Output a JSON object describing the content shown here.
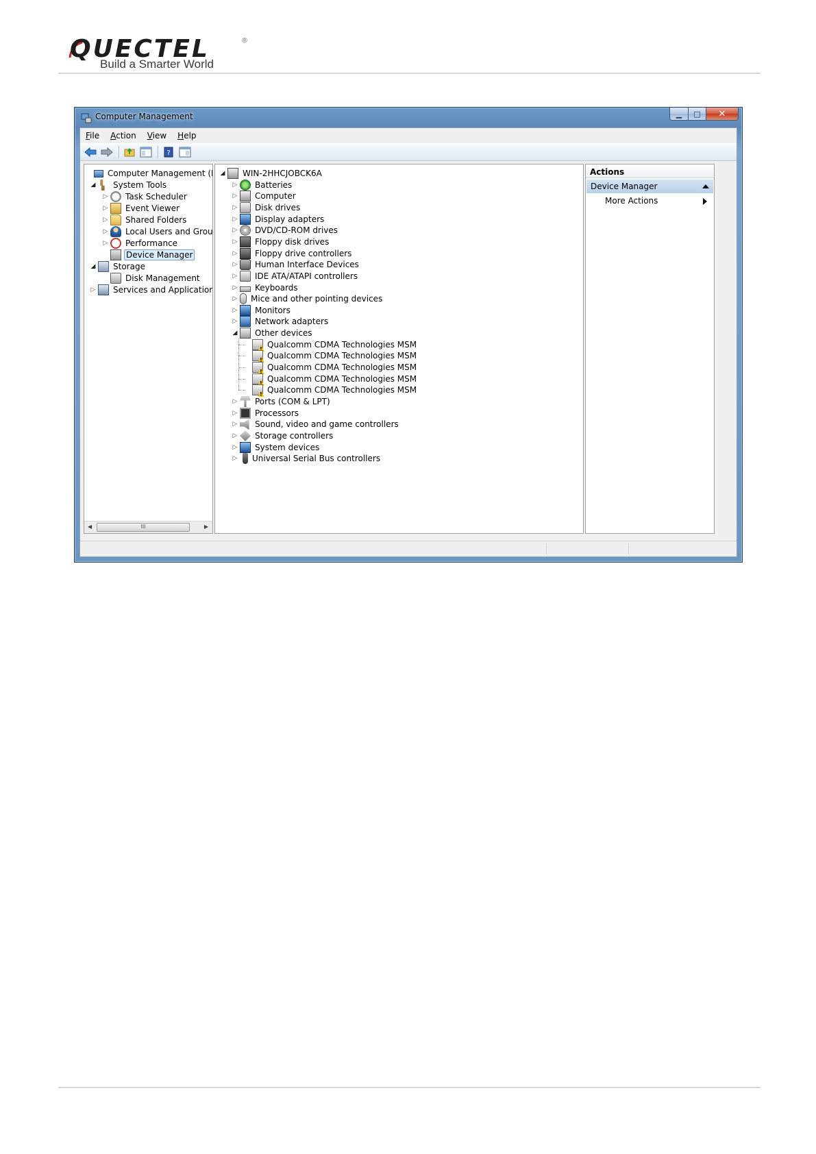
{
  "logo": {
    "wordmark": "QUECTEL",
    "registered": "®",
    "tagline": "Build a Smarter World"
  },
  "window": {
    "title": "Computer Management",
    "caption": {
      "minimize": "▁",
      "maximize": "□",
      "close": "✕"
    }
  },
  "menu": {
    "file": {
      "accel": "F",
      "rest": "ile"
    },
    "action": {
      "accel": "A",
      "rest": "ction"
    },
    "view": {
      "accel": "V",
      "rest": "iew"
    },
    "help": {
      "accel": "H",
      "rest": "elp"
    }
  },
  "left_tree": [
    {
      "label": "Computer Management (Local",
      "icon": "computer-management-icon"
    },
    {
      "label": "System Tools",
      "icon": "system-tools-icon"
    },
    {
      "label": "Task Scheduler",
      "icon": "task-scheduler-icon"
    },
    {
      "label": "Event Viewer",
      "icon": "event-viewer-icon"
    },
    {
      "label": "Shared Folders",
      "icon": "shared-folders-icon"
    },
    {
      "label": "Local Users and Groups",
      "icon": "local-users-icon"
    },
    {
      "label": "Performance",
      "icon": "performance-icon"
    },
    {
      "label": "Device Manager",
      "icon": "device-manager-icon"
    },
    {
      "label": "Storage",
      "icon": "storage-icon"
    },
    {
      "label": "Disk Management",
      "icon": "disk-management-icon"
    },
    {
      "label": "Services and Applications",
      "icon": "services-icon"
    }
  ],
  "left_scroll": {
    "thumb": "III"
  },
  "device_tree": {
    "root": "WIN-2HHCJOBCK6A",
    "categories": [
      "Batteries",
      "Computer",
      "Disk drives",
      "Display adapters",
      "DVD/CD-ROM drives",
      "Floppy disk drives",
      "Floppy drive controllers",
      "Human Interface Devices",
      "IDE ATA/ATAPI controllers",
      "Keyboards",
      "Mice and other pointing devices",
      "Monitors",
      "Network adapters",
      "Other devices"
    ],
    "other_devices": [
      "Qualcomm CDMA Technologies MSM",
      "Qualcomm CDMA Technologies MSM",
      "Qualcomm CDMA Technologies MSM",
      "Qualcomm CDMA Technologies MSM",
      "Qualcomm CDMA Technologies MSM"
    ],
    "after": [
      "Ports (COM & LPT)",
      "Processors",
      "Sound, video and game controllers",
      "Storage controllers",
      "System devices",
      "Universal Serial Bus controllers"
    ]
  },
  "actions": {
    "title": "Actions",
    "section": "Device Manager",
    "more": "More Actions"
  }
}
